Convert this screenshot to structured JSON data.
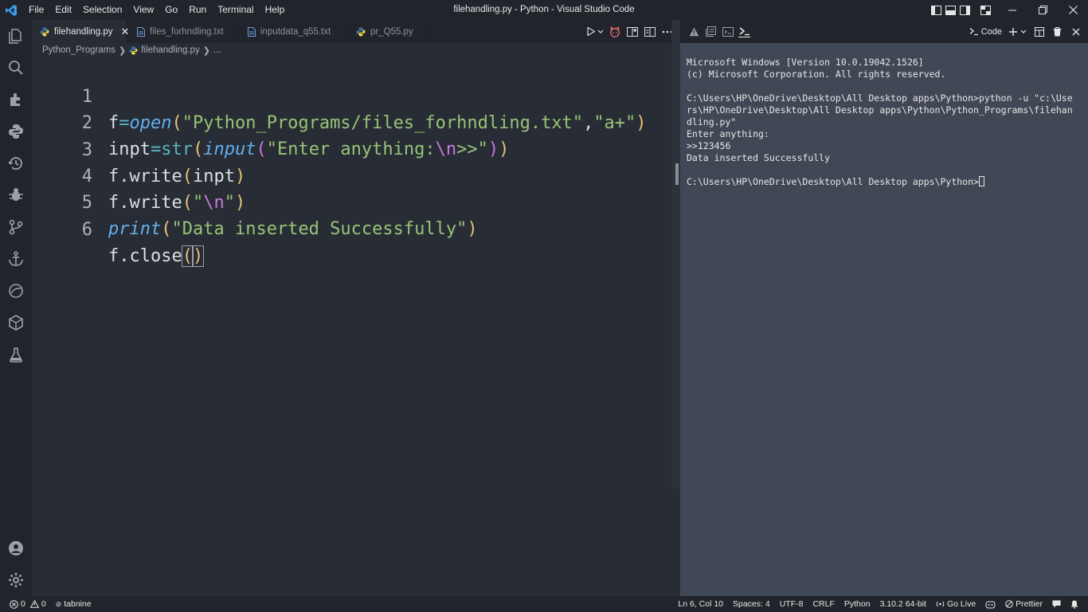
{
  "window": {
    "title": "filehandling.py - Python - Visual Studio Code"
  },
  "menu": [
    "File",
    "Edit",
    "Selection",
    "View",
    "Go",
    "Run",
    "Terminal",
    "Help"
  ],
  "tabs": [
    {
      "label": "filehandling.py",
      "icon": "python-file-icon",
      "active": true
    },
    {
      "label": "files_forhndling.txt",
      "icon": "text-file-icon",
      "active": false
    },
    {
      "label": "inputdata_q55.txt",
      "icon": "text-file-icon",
      "active": false
    },
    {
      "label": "pr_Q55.py",
      "icon": "python-file-icon",
      "active": false
    }
  ],
  "breadcrumb": {
    "folder": "Python_Programs",
    "file": "filehandling.py",
    "more": "..."
  },
  "code": {
    "line_numbers": [
      "1",
      "2",
      "3",
      "4",
      "5",
      "6"
    ],
    "lines": [
      "f=open(\"Python_Programs/files_forhndling.txt\",\"a+\")",
      "inpt=str(input(\"Enter anything:\\n>>\"))",
      "f.write(inpt)",
      "f.write(\"\\n\")",
      "print(\"Data inserted Successfully\")",
      "f.close()"
    ]
  },
  "panel": {
    "terminal_label": "Code",
    "output": [
      "Microsoft Windows [Version 10.0.19042.1526]",
      "(c) Microsoft Corporation. All rights reserved.",
      "",
      "C:\\Users\\HP\\OneDrive\\Desktop\\All Desktop apps\\Python>python -u \"c:\\Use",
      "rs\\HP\\OneDrive\\Desktop\\All Desktop apps\\Python\\Python_Programs\\filehan",
      "dling.py\"",
      "Enter anything:",
      ">>123456",
      "Data inserted Successfully",
      "",
      "C:\\Users\\HP\\OneDrive\\Desktop\\All Desktop apps\\Python>"
    ]
  },
  "statusbar": {
    "errors": "0",
    "warnings": "0",
    "tabnine": "tabnine",
    "position": "Ln 6, Col 10",
    "spaces": "Spaces: 4",
    "encoding": "UTF-8",
    "eol": "CRLF",
    "language": "Python",
    "interpreter": "3.10.2 64-bit",
    "go_live": "Go Live",
    "prettier": "Prettier"
  },
  "colors": {
    "editor_bg": "#282c34",
    "chrome_bg": "#21252b",
    "terminal_bg": "#414855",
    "accent_blue": "#61afef",
    "string_green": "#98c379",
    "bracket_yellow": "#e5c07b",
    "keyword_cyan": "#56b6c2"
  }
}
